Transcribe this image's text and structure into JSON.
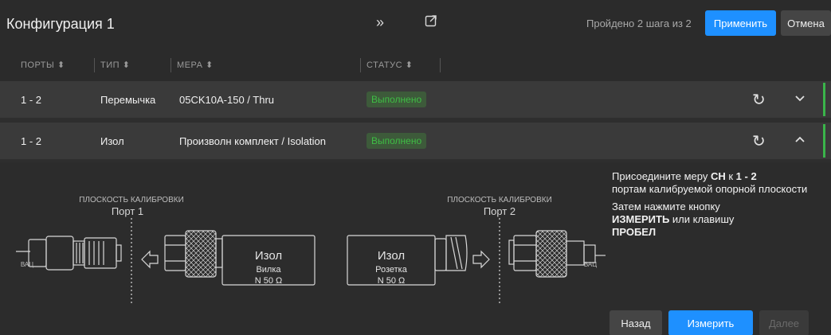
{
  "header": {
    "title": "Конфигурация 1",
    "icons": [
      "double-chevron-right-icon",
      "external-link-icon"
    ],
    "steps_text": "Пройдено 2 шага из 2",
    "apply_label": "Применить",
    "cancel_label": "Отмена"
  },
  "table": {
    "columns": [
      "ПОРТЫ ⬍",
      "ТИП ⬍",
      "МЕРА ⬍",
      "СТАТУС ⬍"
    ],
    "rows": [
      {
        "ports": "1 - 2",
        "type": "Перемычка",
        "measure": "05CK10A-150 / Thru",
        "status": "Выполнено",
        "expanded": false
      },
      {
        "ports": "1 - 2",
        "type": "Изол",
        "measure": "Произволн комплект / Isolation",
        "status": "Выполнено",
        "expanded": true
      }
    ],
    "status_color": "#3fbd45"
  },
  "diagram": {
    "plane_label": "ПЛОСКОСТЬ КАЛИБРОВКИ",
    "port1": "Порт 1",
    "port2": "Порт 2",
    "vna_label": "ВАЦ",
    "left_std": {
      "name": "Изол",
      "kind": "Вилка",
      "spec": "N 50 Ω"
    },
    "right_std": {
      "name": "Изол",
      "kind": "Розетка",
      "spec": "N 50 Ω"
    }
  },
  "instructions": {
    "l1_a": "Присоедините меру ",
    "l1_b": "СН",
    "l1_c": " к ",
    "l1_d": "1 - 2",
    "l2": "портам калибруемой опорной плоскости",
    "l3": "Затем нажмите кнопку ",
    "l4_a": "ИЗМЕРИТЬ",
    "l4_b": " или клавишу ",
    "l4_c": "ПРОБЕЛ"
  },
  "footer": {
    "back_label": "Назад",
    "measure_label": "Измерить",
    "next_label": "Далее"
  },
  "colors": {
    "accent": "#1e90ff",
    "success": "#3ab54a"
  }
}
